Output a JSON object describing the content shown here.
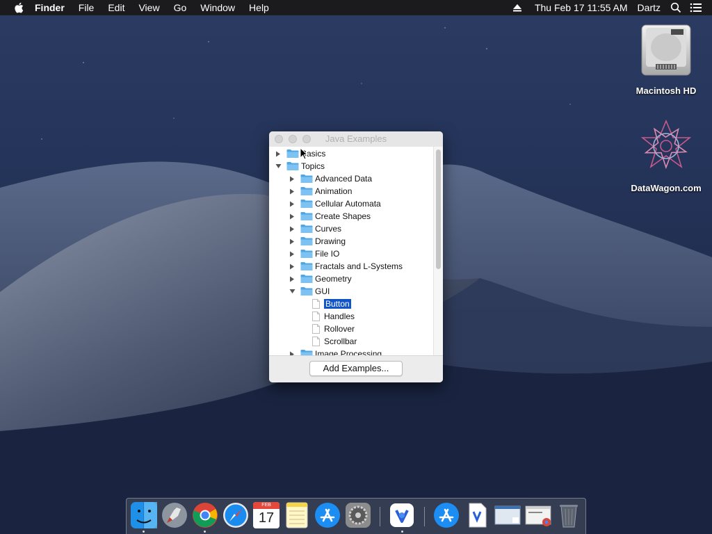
{
  "menubar": {
    "app": "Finder",
    "items": [
      "File",
      "Edit",
      "View",
      "Go",
      "Window",
      "Help"
    ],
    "datetime": "Thu Feb 17  11:55 AM",
    "user": "Dartz",
    "icons": [
      "apple-icon",
      "eject-icon",
      "search-icon",
      "control-center-icon"
    ]
  },
  "desktop_icons": [
    {
      "label": "Macintosh HD",
      "icon": "hard-drive-icon"
    },
    {
      "label": "DataWagon.com",
      "icon": "star-pattern-icon"
    }
  ],
  "window": {
    "title": "Java Examples",
    "tree": [
      {
        "label": "Basics",
        "type": "folder",
        "expanded": false,
        "level": 0
      },
      {
        "label": "Topics",
        "type": "folder",
        "expanded": true,
        "level": 0
      },
      {
        "label": "Advanced Data",
        "type": "folder",
        "expanded": false,
        "level": 1
      },
      {
        "label": "Animation",
        "type": "folder",
        "expanded": false,
        "level": 1
      },
      {
        "label": "Cellular Automata",
        "type": "folder",
        "expanded": false,
        "level": 1
      },
      {
        "label": "Create Shapes",
        "type": "folder",
        "expanded": false,
        "level": 1
      },
      {
        "label": "Curves",
        "type": "folder",
        "expanded": false,
        "level": 1
      },
      {
        "label": "Drawing",
        "type": "folder",
        "expanded": false,
        "level": 1
      },
      {
        "label": "File IO",
        "type": "folder",
        "expanded": false,
        "level": 1
      },
      {
        "label": "Fractals and L-Systems",
        "type": "folder",
        "expanded": false,
        "level": 1
      },
      {
        "label": "Geometry",
        "type": "folder",
        "expanded": false,
        "level": 1
      },
      {
        "label": "GUI",
        "type": "folder",
        "expanded": true,
        "level": 1
      },
      {
        "label": "Button",
        "type": "file",
        "selected": true,
        "level": 2
      },
      {
        "label": "Handles",
        "type": "file",
        "level": 2
      },
      {
        "label": "Rollover",
        "type": "file",
        "level": 2
      },
      {
        "label": "Scrollbar",
        "type": "file",
        "level": 2
      },
      {
        "label": "Image Processing",
        "type": "folder",
        "expanded": false,
        "level": 1
      }
    ],
    "button_label": "Add Examples..."
  },
  "dock": {
    "apps": [
      "finder-icon",
      "launchpad-icon",
      "chrome-icon",
      "safari-icon",
      "calendar-icon",
      "notes-icon",
      "app-store-icon",
      "system-preferences-icon",
      "datawagon-app-icon",
      "app-store-downloads-icon",
      "document-icon",
      "window-preview-icon",
      "chrome-window-icon",
      "trash-icon"
    ],
    "calendar_month": "FEB",
    "calendar_day": "17"
  },
  "colors": {
    "selection": "#1055c8",
    "folder": "#5eb2ec"
  }
}
